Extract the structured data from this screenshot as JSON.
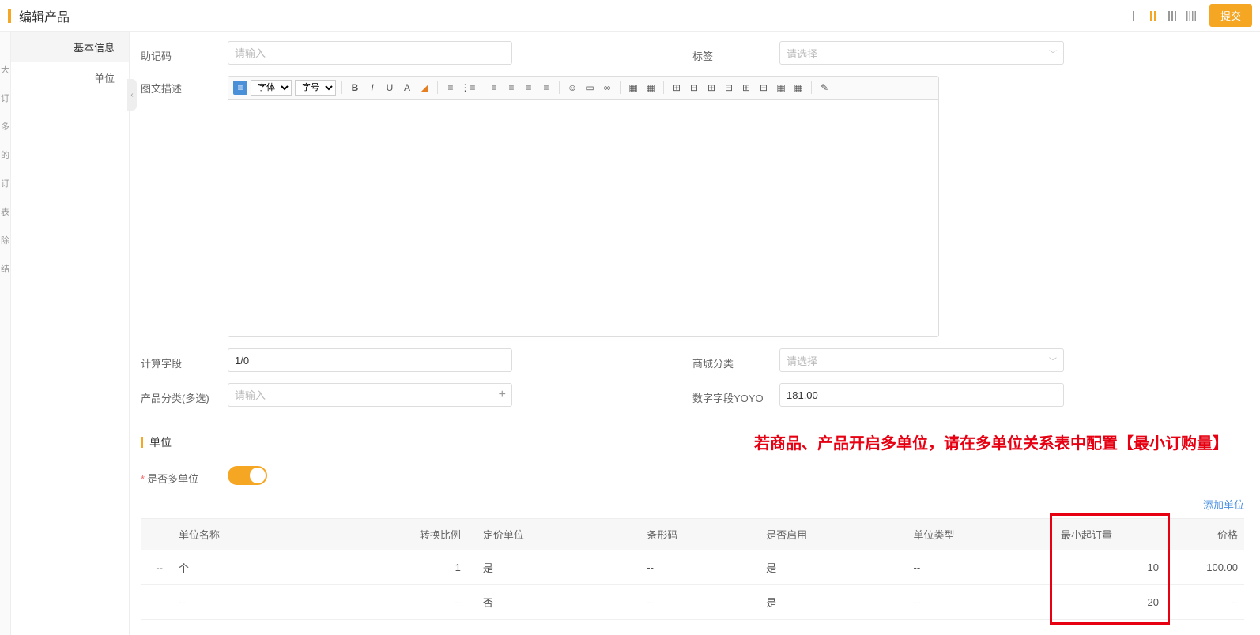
{
  "header": {
    "title": "编辑产品",
    "submit": "提交"
  },
  "sidebar": {
    "items": [
      {
        "label": "基本信息",
        "active": true
      },
      {
        "label": "单位",
        "active": false
      }
    ]
  },
  "form": {
    "mnemonic_label": "助记码",
    "mnemonic_placeholder": "请输入",
    "tags_label": "标签",
    "tags_placeholder": "请选择",
    "desc_label": "图文描述",
    "font_family": "字体",
    "font_size": "字号",
    "calc_label": "计算字段",
    "calc_value": "1/0",
    "mall_cat_label": "商城分类",
    "mall_cat_placeholder": "请选择",
    "prod_cat_label": "产品分类(多选)",
    "prod_cat_placeholder": "请输入",
    "num_field_label": "数字字段YOYO",
    "num_field_value": "181.00"
  },
  "unit_section": {
    "title": "单位",
    "annotation": "若商品、产品开启多单位，请在多单位关系表中配置【最小订购量】",
    "multi_unit_label": "是否多单位",
    "add_unit": "添加单位"
  },
  "unit_table": {
    "headers": {
      "name": "单位名称",
      "ratio": "转换比例",
      "price_unit": "定价单位",
      "barcode": "条形码",
      "enabled": "是否启用",
      "type": "单位类型",
      "min_order": "最小起订量",
      "price": "价格"
    },
    "rows": [
      {
        "idx": "--",
        "name": "个",
        "ratio": "1",
        "price_unit": "是",
        "barcode": "--",
        "enabled": "是",
        "type": "--",
        "min_order": "10",
        "price": "100.00"
      },
      {
        "idx": "--",
        "name": "--",
        "ratio": "--",
        "price_unit": "否",
        "barcode": "--",
        "enabled": "是",
        "type": "--",
        "min_order": "20",
        "price": "--"
      }
    ]
  }
}
